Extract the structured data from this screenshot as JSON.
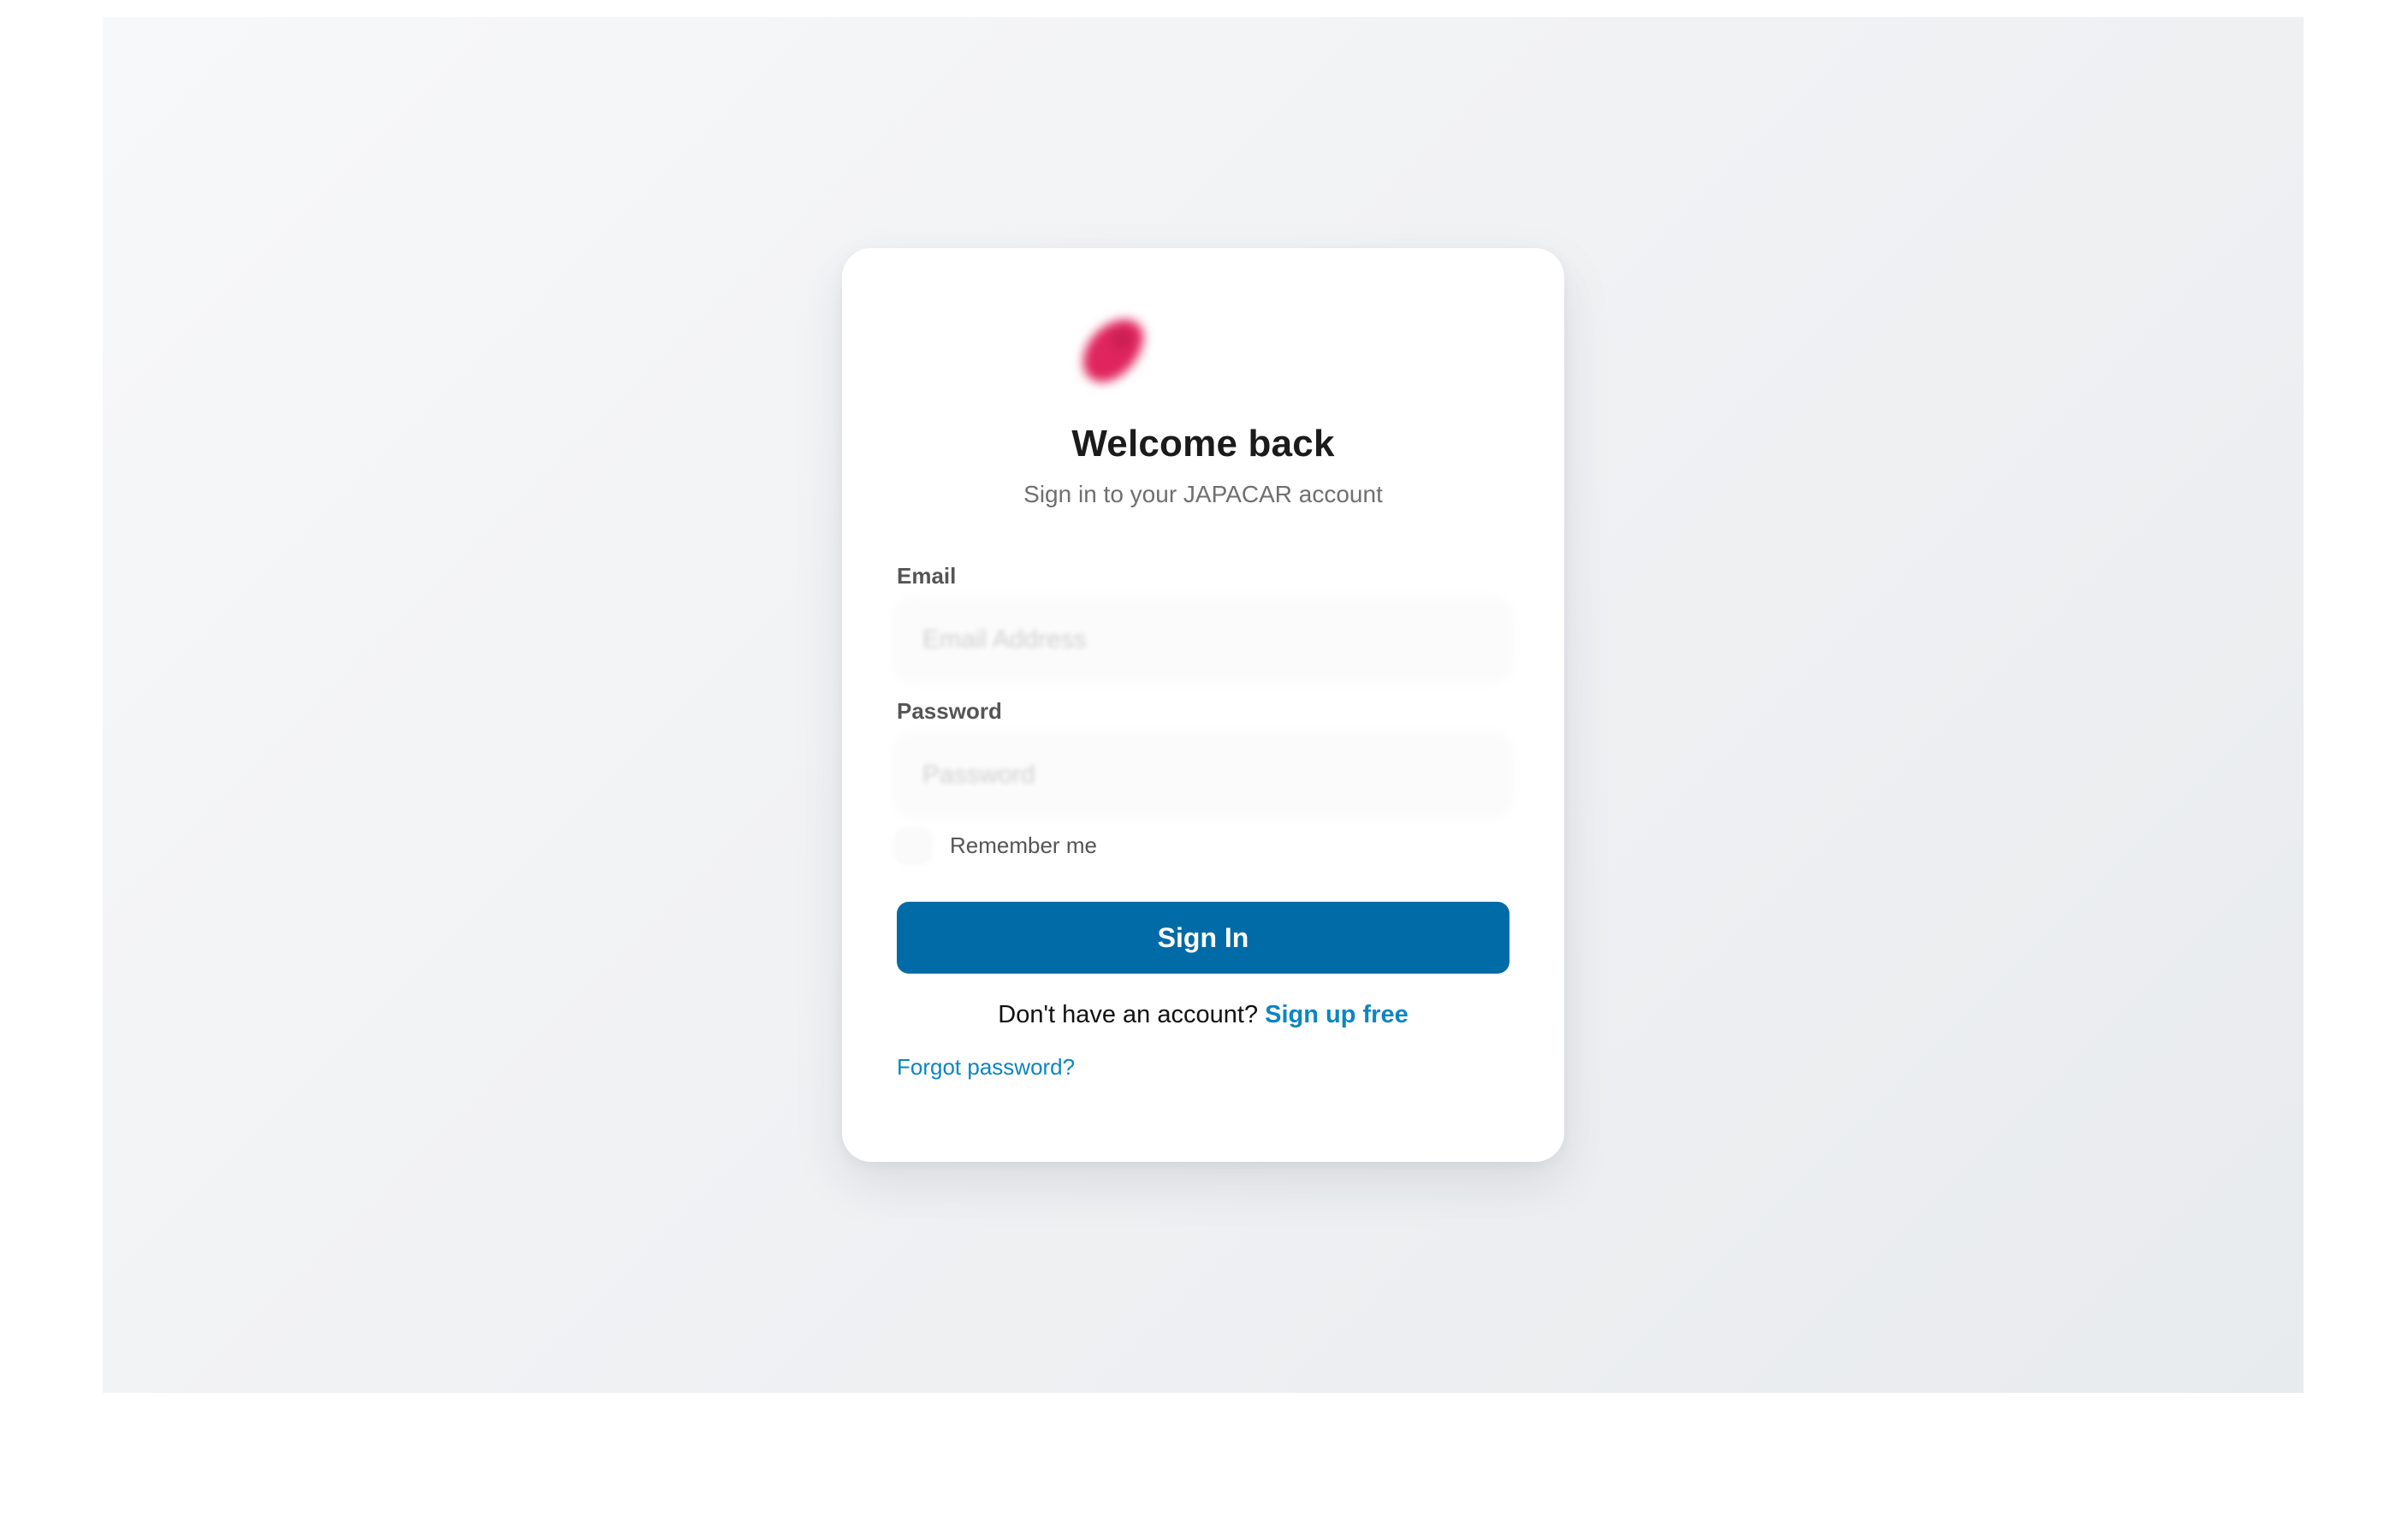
{
  "brand": {
    "logo_icon": "brand-logo-icon",
    "logo_color": "#e0245e"
  },
  "header": {
    "title": "Welcome back",
    "subtitle": "Sign in to your JAPACAR account"
  },
  "form": {
    "email": {
      "label": "Email",
      "placeholder": "Email Address",
      "value": ""
    },
    "password": {
      "label": "Password",
      "placeholder": "Password",
      "value": ""
    },
    "remember_label": "Remember me",
    "submit_label": "Sign In"
  },
  "footer": {
    "signup_prompt": "Don't have an account?",
    "signup_link": "Sign up free",
    "forgot_link": "Forgot password?"
  },
  "colors": {
    "primary_button": "#006ba6",
    "link": "#0b86c2",
    "title": "#1b1b1b",
    "muted": "#6f6f6f"
  }
}
